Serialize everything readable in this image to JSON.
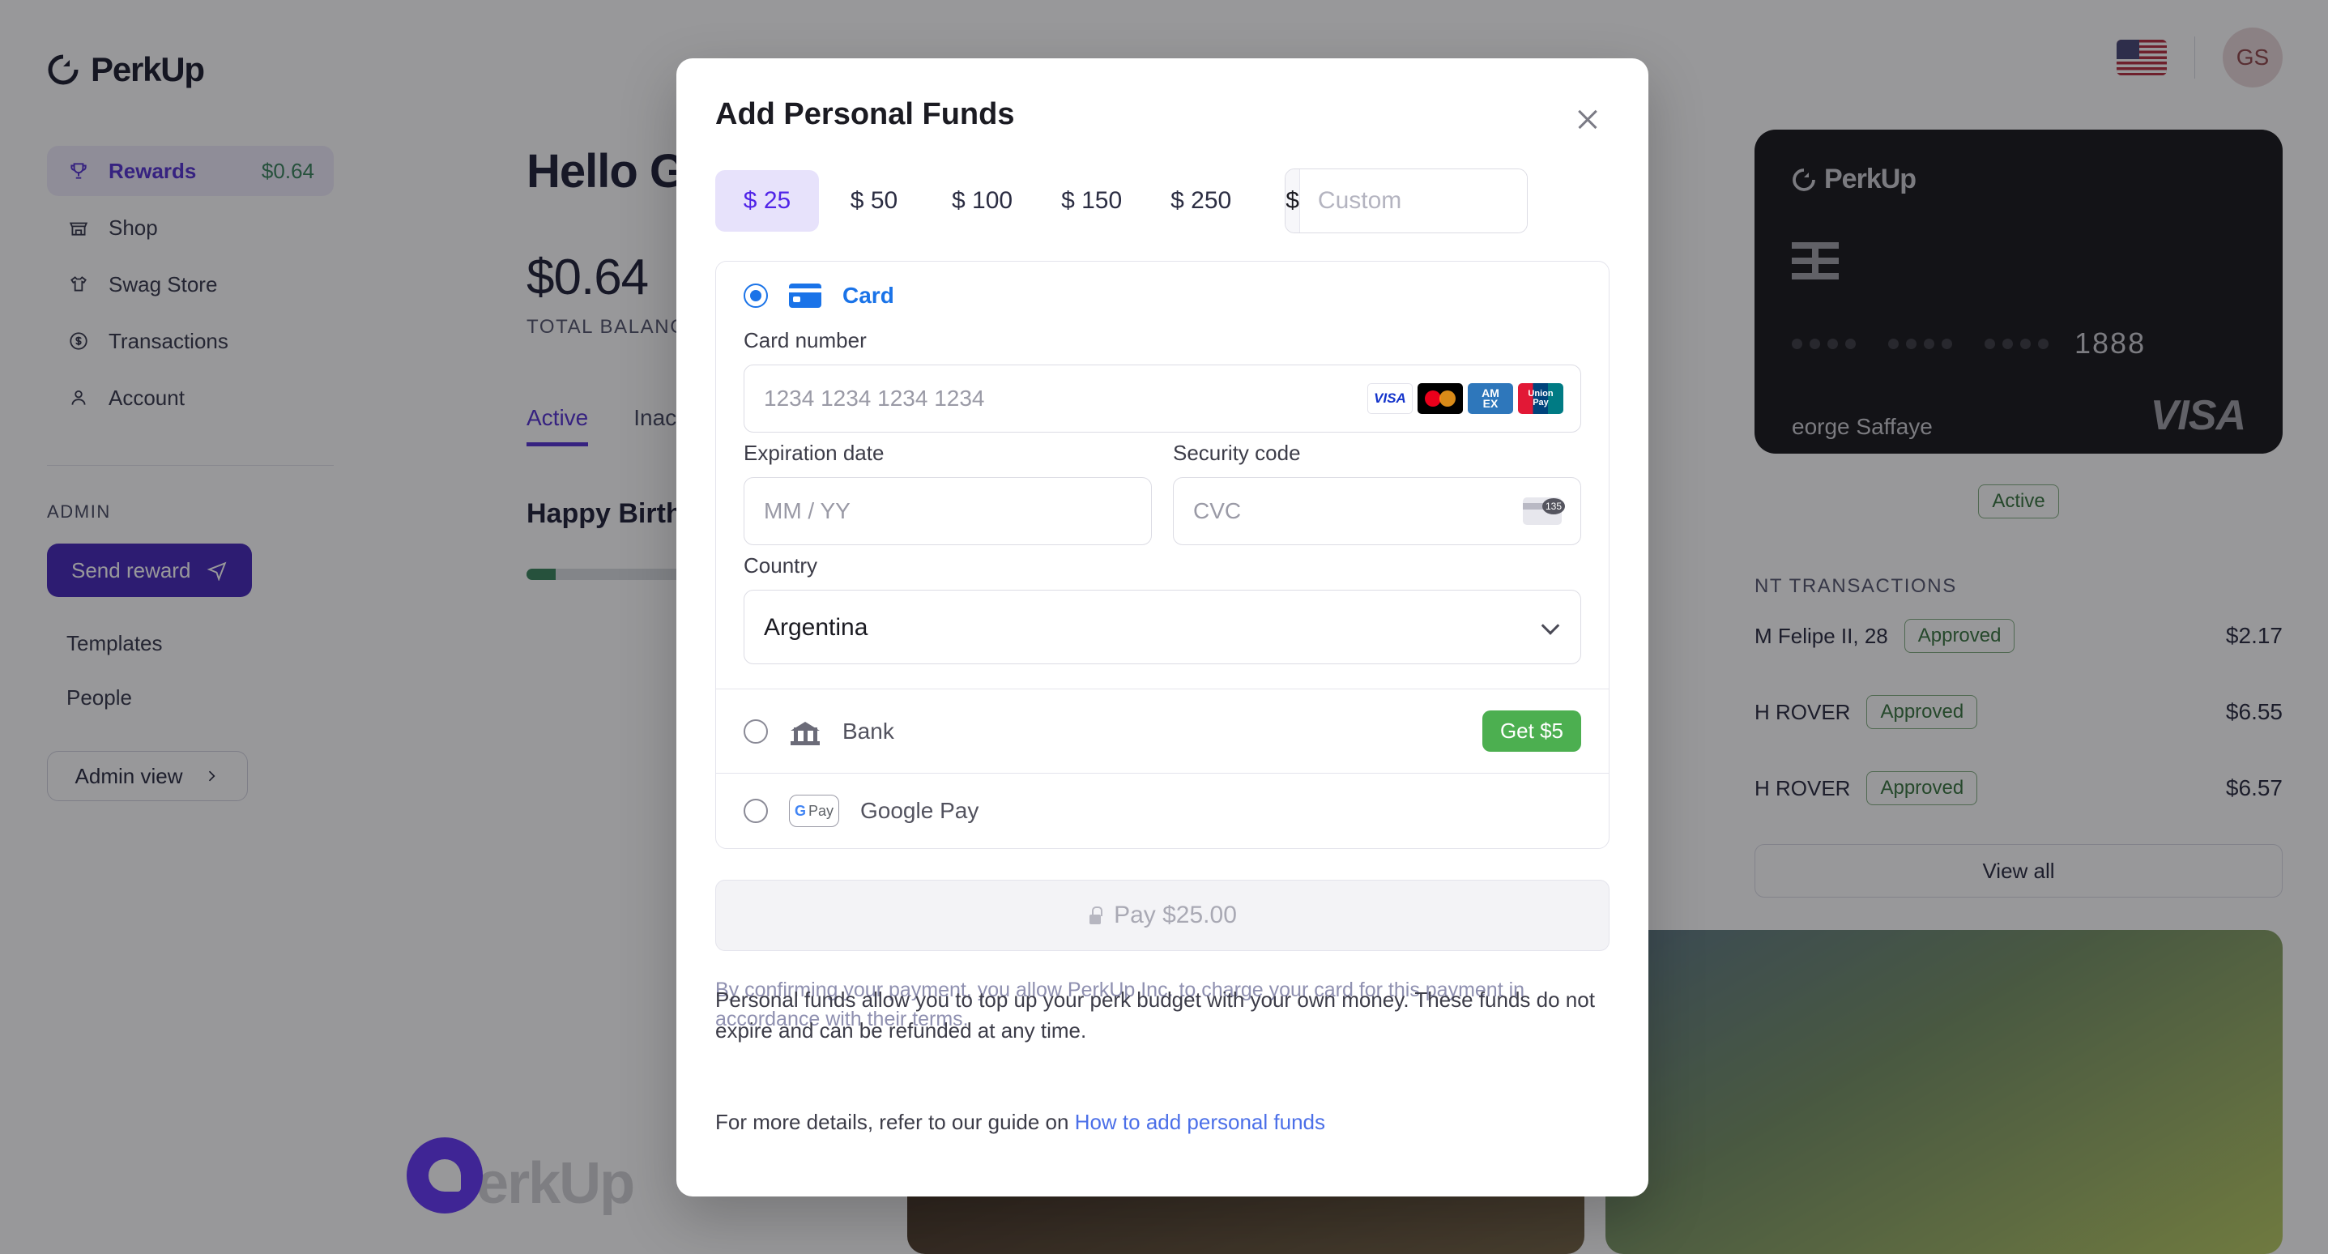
{
  "sidebar": {
    "brand": "PerkUp",
    "items": [
      {
        "label": "Rewards",
        "amount": "$0.64",
        "icon": "trophy-icon"
      },
      {
        "label": "Shop",
        "amount": "",
        "icon": "store-icon"
      },
      {
        "label": "Swag Store",
        "amount": "",
        "icon": "tshirt-icon"
      },
      {
        "label": "Transactions",
        "amount": "",
        "icon": "dollar-circle-icon"
      },
      {
        "label": "Account",
        "amount": "",
        "icon": "user-icon"
      }
    ],
    "admin_section_title": "ADMIN",
    "send_reward_label": "Send reward",
    "templates_label": "Templates",
    "people_label": "People",
    "admin_view_label": "Admin view"
  },
  "header": {
    "locale_flag": "us-flag-icon",
    "avatar_initials": "GS"
  },
  "main": {
    "greeting": "Hello Ge",
    "balance": "$0.64",
    "balance_label": "TOTAL BALANC",
    "tabs": [
      {
        "label": "Active",
        "active": true
      },
      {
        "label": "Inact",
        "active": false
      }
    ],
    "perk_title": "Happy Birtho",
    "watermark": "PerkUp"
  },
  "card": {
    "brand": "PerkUp",
    "masked_dots": "•••• •••• ••••",
    "last4": "1888",
    "holder": "eorge Saffaye",
    "network": "VISA",
    "status": "Active"
  },
  "transactions": {
    "title": "NT TRANSACTIONS",
    "rows": [
      {
        "name": "M Felipe II, 28",
        "status": "Approved",
        "amount": "$2.17"
      },
      {
        "name": "H ROVER",
        "status": "Approved",
        "amount": "$6.55"
      },
      {
        "name": "H ROVER",
        "status": "Approved",
        "amount": "$6.57"
      }
    ],
    "view_all_label": "View all"
  },
  "modal": {
    "title": "Add Personal Funds",
    "amounts": [
      {
        "label": "$ 25",
        "selected": true
      },
      {
        "label": "$ 50",
        "selected": false
      },
      {
        "label": "$ 100",
        "selected": false
      },
      {
        "label": "$ 150",
        "selected": false
      },
      {
        "label": "$ 250",
        "selected": false
      }
    ],
    "custom_prefix": "$",
    "custom_placeholder": "Custom",
    "custom_value": "",
    "methods": {
      "card_label": "Card",
      "bank_label": "Bank",
      "bank_badge": "Get $5",
      "gpay_label": "Google Pay",
      "gpay_mark": "G Pay"
    },
    "form": {
      "card_number_label": "Card number",
      "card_number_placeholder": "1234 1234 1234 1234",
      "card_number_value": "",
      "expiry_label": "Expiration date",
      "expiry_placeholder": "MM / YY",
      "expiry_value": "",
      "cvc_label": "Security code",
      "cvc_placeholder": "CVC",
      "cvc_value": "",
      "cvc_hint": "135",
      "country_label": "Country",
      "country_value": "Argentina"
    },
    "brands": [
      {
        "name": "VISA"
      },
      {
        "name": "Mastercard"
      },
      {
        "name": "AMEX"
      },
      {
        "name": "UnionPay"
      }
    ],
    "pay_button_label": "Pay $25.00",
    "stripe_legal": "By confirming your payment, you allow PerkUp Inc. to charge your card for this payment in accordance with their terms.",
    "funds_legal": "Personal funds allow you to top up your perk budget with your own money. These funds do not expire and can be refunded at any time.",
    "guide_prefix": "For more details, refer to our guide on",
    "guide_link": "How to add personal funds"
  },
  "colors": {
    "accent_purple": "#4b26cf",
    "selected_chip_bg": "#e7e2fb",
    "stripe_blue": "#1a73e8",
    "green": "#4caf50"
  }
}
